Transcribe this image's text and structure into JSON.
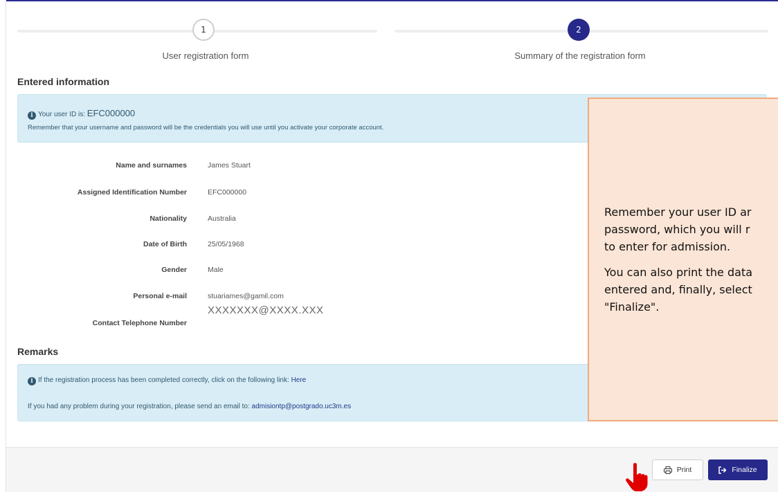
{
  "stepper": {
    "steps": [
      {
        "number": "1",
        "label": "User registration form"
      },
      {
        "number": "2",
        "label": "Summary of the registration form"
      }
    ]
  },
  "entered_info": {
    "title": "Entered information",
    "user_id_prefix": "Your user ID is:",
    "user_id": "EFC000000",
    "reminder": "Remember that your username and password will be the credentials you will use until you activate your corporate account."
  },
  "fields": [
    {
      "label": "Name and surnames",
      "value": "James Stuart"
    },
    {
      "label": "Assigned Identification Number",
      "value": "EFC000000"
    },
    {
      "label": "Nationality",
      "value": "Australia"
    },
    {
      "label": "Date of Birth",
      "value": "25/05/1968"
    },
    {
      "label": "Gender",
      "value": "Male"
    },
    {
      "label": "Personal e-mail",
      "value": "stuariames@gamil.com"
    },
    {
      "label": "Contact Telephone Number",
      "value": "XXXXXXX@XXXX.XXX"
    }
  ],
  "remarks": {
    "title": "Remarks",
    "line1_text": "If the registration process has been completed correctly, click on the following link:",
    "line1_link": "Here",
    "line2_text": "If you had any problem during your registration, please send an email to:",
    "line2_link": "admisiontp@postgrado.uc3m.es"
  },
  "buttons": {
    "print": "Print",
    "finalize": "Finalize"
  },
  "callout": {
    "paragraph1": "Remember your user ID ar\npassword, which you will r\nto enter for admission.",
    "paragraph2": "You can also print the data\nentered and, finally, select\n\"Finalize\"."
  },
  "colors": {
    "primary": "#26288a",
    "info_bg": "#d9edf6",
    "callout_bg": "#fbe5d6",
    "callout_border": "#f2a97a",
    "hand": "#e00000"
  }
}
